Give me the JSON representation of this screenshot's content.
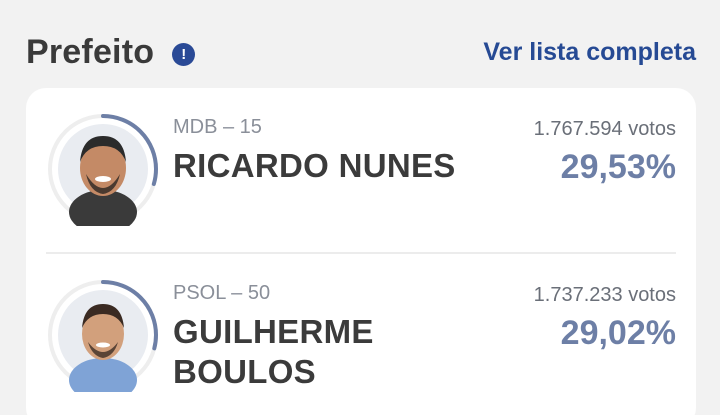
{
  "header": {
    "title": "Prefeito",
    "info_icon": "info-icon",
    "link_label": "Ver lista completa"
  },
  "colors": {
    "accent_blue": "#264a94",
    "percent": "#6d7fa6",
    "progress_ring": "#6d7fa6"
  },
  "candidates": [
    {
      "party": "MDB – 15",
      "name": "RICARDO NUNES",
      "votes": "1.767.594 votos",
      "percent": "29,53%",
      "share": 0.2953
    },
    {
      "party": "PSOL – 50",
      "name": "GUILHERME BOULOS",
      "votes": "1.737.233 votos",
      "percent": "29,02%",
      "share": 0.2902
    }
  ]
}
